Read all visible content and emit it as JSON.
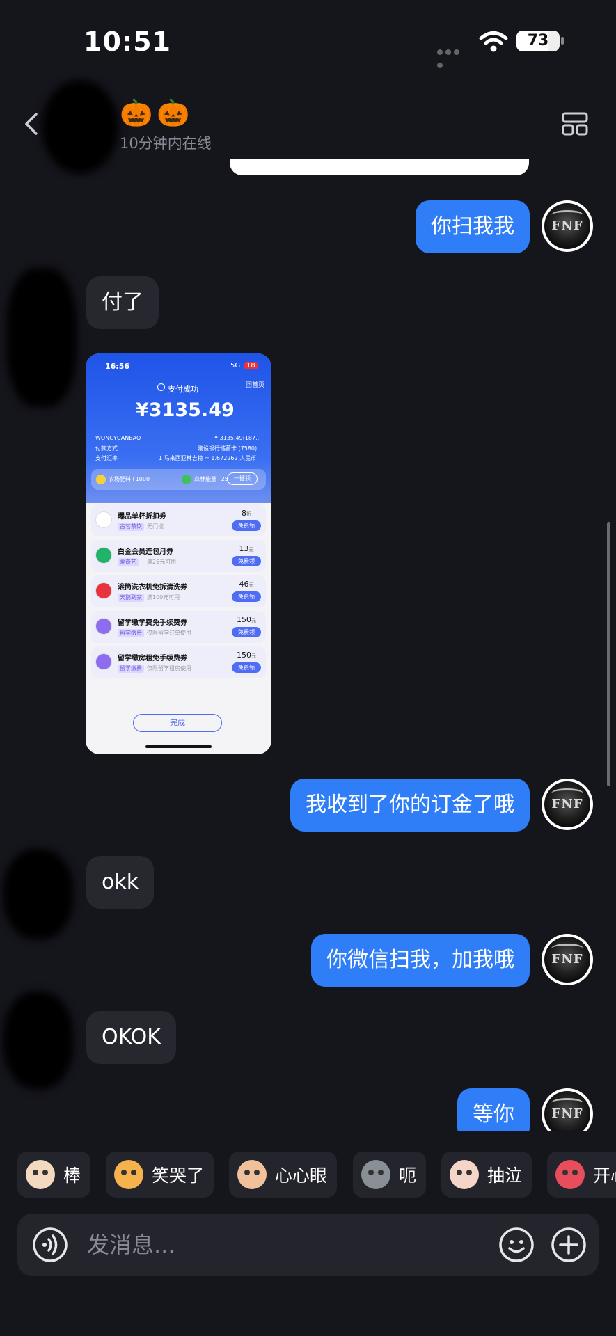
{
  "status_bar": {
    "time": "10:51",
    "battery": "73",
    "battery_level": 0.73
  },
  "header": {
    "emoji": "🎃🎃",
    "subtitle": "10分钟内在线"
  },
  "messages": [
    {
      "from": "me",
      "text": "你扫我我"
    },
    {
      "from": "them",
      "text": "付了"
    },
    {
      "from": "me",
      "text": "我收到了你的订金了哦"
    },
    {
      "from": "them",
      "text": "okk"
    },
    {
      "from": "me",
      "text": "你微信扫我，加我哦"
    },
    {
      "from": "them",
      "text": "OKOK"
    },
    {
      "from": "me",
      "text": "等你"
    }
  ],
  "avatar_text": "FNF",
  "payment_screenshot": {
    "time": "16:56",
    "network": "5G",
    "battery": "18",
    "home_link": "回首页",
    "status": "支付成功",
    "amount": "¥3135.49",
    "merchant": "WONGYUANBAO",
    "merchant_amount": "¥ 3135.49(187...",
    "method_label": "付款方式",
    "method_value": "建设银行储蓄卡 (7580)",
    "rate_label": "支付汇率",
    "rate_value": "1 马来西亚林吉特 = 1.672262 人民币",
    "reward1": "农场肥料+1000",
    "reward2": "森林能量+25",
    "reward_btn": "一键领",
    "coupons": [
      {
        "title": "爆品单杯折扣券",
        "tag": "古茗茶饮",
        "sub": "无门槛",
        "num": "8",
        "unit": "折",
        "btn": "免费领",
        "color": "#ffffff"
      },
      {
        "title": "白金会员连包月券",
        "tag": "爱奇艺",
        "sub": "满26元可用",
        "num": "13",
        "unit": "元",
        "btn": "免费领",
        "color": "#22b36b"
      },
      {
        "title": "滚筒洗衣机免拆清洗券",
        "tag": "天鹅到家",
        "sub": "满100元可用",
        "num": "46",
        "unit": "元",
        "btn": "免费领",
        "color": "#e8323c"
      },
      {
        "title": "留学缴学费免手续费券",
        "tag": "留学缴费",
        "sub": "仅限留学订单使用",
        "num": "150",
        "unit": "元",
        "btn": "免费领",
        "color": "#8e6cf0"
      },
      {
        "title": "留学缴房租免手续费券",
        "tag": "留学缴费",
        "sub": "仅限留学租房使用",
        "num": "150",
        "unit": "元",
        "btn": "免费领",
        "color": "#8e6cf0"
      }
    ],
    "done": "完成"
  },
  "quick_replies": [
    {
      "label": "棒",
      "color": "#f3d9c0"
    },
    {
      "label": "笑哭了",
      "color": "#f6b24d"
    },
    {
      "label": "心心眼",
      "color": "#f0c19a"
    },
    {
      "label": "呃",
      "color": "#8a8f96"
    },
    {
      "label": "抽泣",
      "color": "#f4d5c8"
    },
    {
      "label": "开心",
      "color": "#e84d5b"
    }
  ],
  "input": {
    "placeholder": "发消息..."
  }
}
